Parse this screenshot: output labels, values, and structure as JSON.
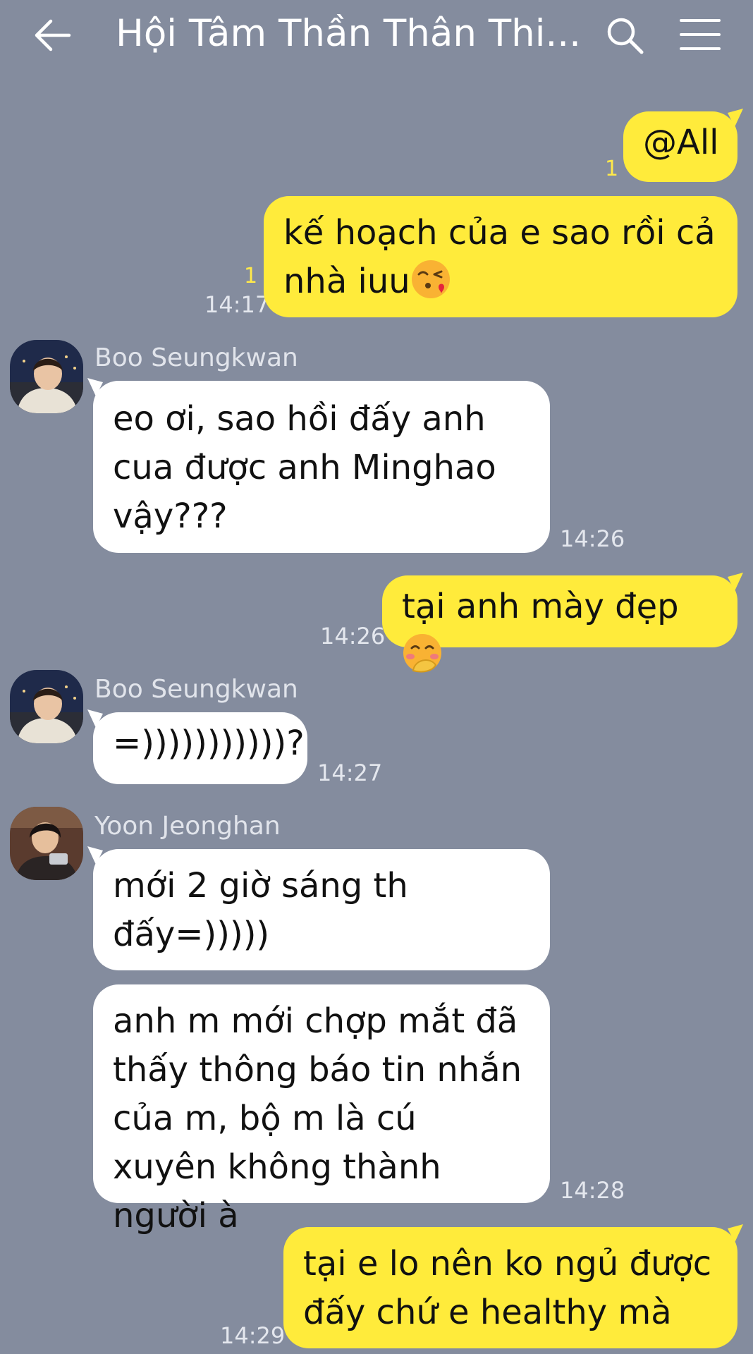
{
  "header": {
    "title": "Hội Tâm Thần Thân Thi...",
    "back_icon": "arrow-left-icon",
    "search_icon": "search-icon",
    "menu_icon": "hamburger-menu-icon"
  },
  "colors": {
    "background": "#848c9e",
    "my_bubble": "#ffeb3b",
    "their_bubble": "#ffffff",
    "unread_count": "#ffe94a"
  },
  "messages": [
    {
      "side": "mine",
      "text": "@All",
      "unread": "1"
    },
    {
      "side": "mine",
      "text": "kế hoạch của e sao rồi cả nhà iuu",
      "emoji": "face-blowing-kiss",
      "unread": "1",
      "time": "14:17"
    },
    {
      "side": "theirs",
      "sender": "Boo Seungkwan",
      "text": "eo ơi, sao hồi đấy anh cua được anh Minghao vậy???",
      "time": "14:26"
    },
    {
      "side": "mine",
      "text": "tại anh mày đẹp",
      "emoji": "face-with-hand-over-mouth",
      "time": "14:26"
    },
    {
      "side": "theirs",
      "sender": "Boo Seungkwan",
      "text": "=)))))))))))?",
      "time": "14:27"
    },
    {
      "side": "theirs",
      "sender": "Yoon Jeonghan",
      "text": "mới 2 giờ sáng th đấy=)))))"
    },
    {
      "side": "theirs",
      "text": "anh m mới chợp mắt đã thấy thông báo tin nhắn của m, bộ m là cú xuyên không thành người à",
      "time": "14:28"
    },
    {
      "side": "mine",
      "text": "tại e lo nên ko ngủ được đấy chứ e healthy mà",
      "time": "14:29"
    }
  ]
}
